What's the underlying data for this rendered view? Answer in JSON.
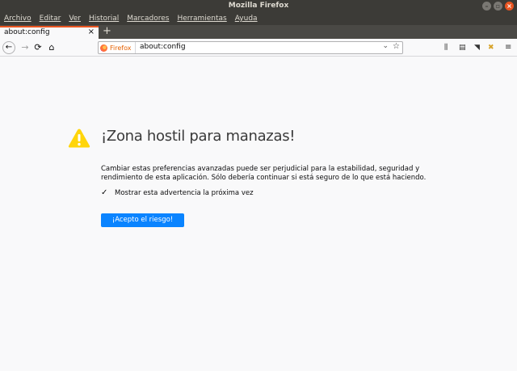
{
  "window": {
    "title": "Mozilla Firefox",
    "min_label": "–",
    "max_label": "▫",
    "close_label": "×"
  },
  "menubar": {
    "items": [
      "Archivo",
      "Editar",
      "Ver",
      "Historial",
      "Marcadores",
      "Herramientas",
      "Ayuda"
    ]
  },
  "tabs": [
    {
      "label": "about:config",
      "close_label": "×"
    }
  ],
  "newtab_label": "+",
  "navbar": {
    "back_label": "←",
    "forward_label": "→",
    "reload_label": "⟳",
    "home_label": "⌂",
    "identity_label": "Firefox",
    "url": "about:config",
    "dropdown_label": "⌄",
    "star_label": "☆",
    "library_label": "⫼",
    "sidebar_label": "▤",
    "pocket_label": "◥",
    "ext_label": "✖",
    "menu_label": "≡"
  },
  "content": {
    "heading": "¡Zona hostil para manazas!",
    "description": "Cambiar estas preferencias avanzadas puede ser perjudicial para la estabilidad, seguridad y rendimiento de esta aplicación. Sólo debería continuar si está seguro de lo que está haciendo.",
    "checkbox_checked": true,
    "checkbox_mark": "✓",
    "checkbox_label": "Mostrar esta advertencia la próxima vez",
    "accept_button": "¡Acepto el riesgo!"
  },
  "colors": {
    "accent": "#0a84ff",
    "warning": "#ffd50a",
    "tab_highlight": "#e95420"
  }
}
